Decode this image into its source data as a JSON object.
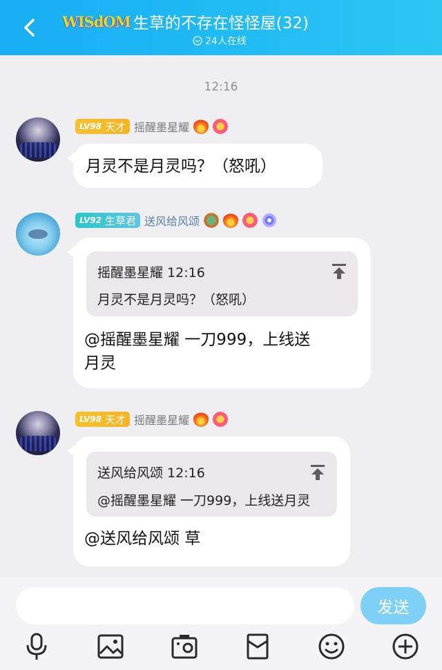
{
  "header": {
    "back_icon": "chevron-left-icon",
    "logo_text": "WISdOM",
    "title": "生草的不存在怪怪屋(32)",
    "online": "24人在线",
    "gradient": [
      "#18aef3",
      "#2cc6f3"
    ]
  },
  "timestamp": "12:16",
  "messages": [
    {
      "level": "LV98",
      "level_title": "天才",
      "level_color": "#f6c12c",
      "nickname": "摇醒墨星耀",
      "badges": [
        "fire-badge-icon",
        "flower-badge-icon"
      ],
      "text": "月灵不是月灵吗？（怒吼）"
    },
    {
      "level": "LV92",
      "level_title": "生草君",
      "level_color": "#27c7c9",
      "nickname": "送风给风颂",
      "badges": [
        "dragon-badge-icon",
        "fire-badge-icon",
        "flower-badge-icon",
        "spiral-badge-icon"
      ],
      "quote": {
        "author_time": "摇醒墨星耀 12:16",
        "text": "月灵不是月灵吗？（怒吼）"
      },
      "text_line1": "@摇醒墨星耀 一刀999，上线送",
      "text_line2": "月灵"
    },
    {
      "level": "LV98",
      "level_title": "天才",
      "level_color": "#f6c12c",
      "nickname": "摇醒墨星耀",
      "badges": [
        "fire-badge-icon",
        "flower-badge-icon"
      ],
      "quote": {
        "author_time": "送风给风颂 12:16",
        "text": "@摇醒墨星耀 一刀999，上线送月灵"
      },
      "text": "@送风给风颂 草"
    }
  ],
  "input": {
    "placeholder": "",
    "send_label": "发送",
    "send_color": "#7fd0f7"
  },
  "toolbar": [
    "microphone-icon",
    "image-icon",
    "camera-icon",
    "red-packet-icon",
    "emoji-icon",
    "plus-icon"
  ]
}
